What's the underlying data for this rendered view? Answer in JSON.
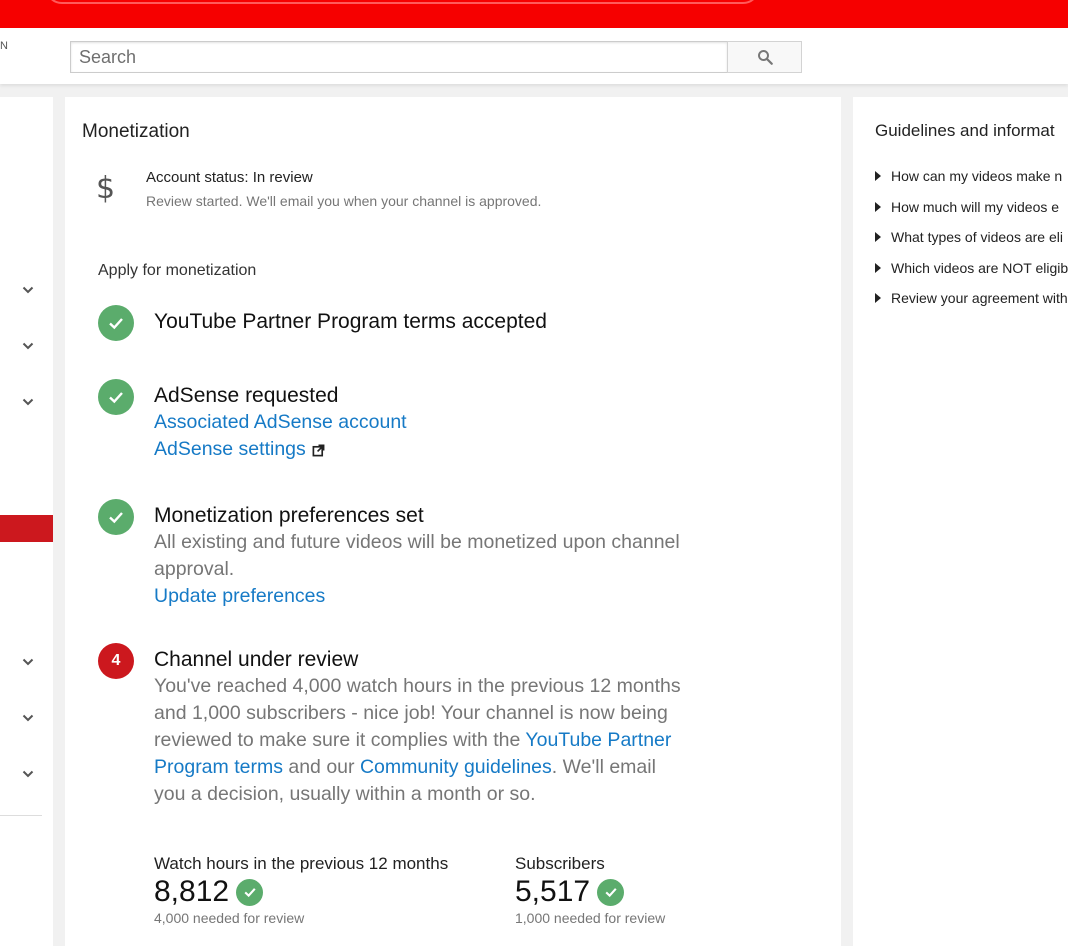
{
  "header": {
    "cut_label": "N",
    "search_placeholder": "Search"
  },
  "main": {
    "title": "Monetization",
    "account_status": "Account status: In review",
    "account_sub": "Review started. We'll email you when your channel is approved.",
    "apply_heading": "Apply for monetization",
    "steps": [
      {
        "title": "YouTube Partner Program terms accepted"
      },
      {
        "title": "AdSense requested",
        "link1": "Associated AdSense account",
        "link2": "AdSense settings"
      },
      {
        "title": "Monetization preferences set",
        "text": "All existing and future videos will be monetized upon channel approval.",
        "link": "Update preferences"
      },
      {
        "number": "4",
        "title": "Channel under review",
        "text1": "You've reached 4,000 watch hours in the previous 12 months and 1,000 subscribers - nice job! Your channel is now being reviewed to make sure it complies with the ",
        "link1": "YouTube Partner Program terms",
        "text2": " and our ",
        "link2": "Community guidelines",
        "text3": ". We'll email you a decision, usually within a month or so."
      }
    ],
    "stats": [
      {
        "label": "Watch hours in the previous 12 months",
        "value": "8,812",
        "note": "4,000 needed for review"
      },
      {
        "label": "Subscribers",
        "value": "5,517",
        "note": "1,000 needed for review"
      }
    ]
  },
  "guidelines": {
    "title": "Guidelines and informat",
    "items": [
      "How can my videos make n",
      "How much will my videos e",
      "What types of videos are eli",
      "Which videos are NOT eligib",
      "Review your agreement with"
    ]
  },
  "colors": {
    "brand_red": "#f60000",
    "done_green": "#5bac6c",
    "link_blue": "#167ac6",
    "step_red": "#cc181e"
  },
  "icons": [
    "search-icon",
    "chevron-down-icon",
    "dollar-icon",
    "check-icon",
    "external-link-icon",
    "triangle-right-icon"
  ]
}
